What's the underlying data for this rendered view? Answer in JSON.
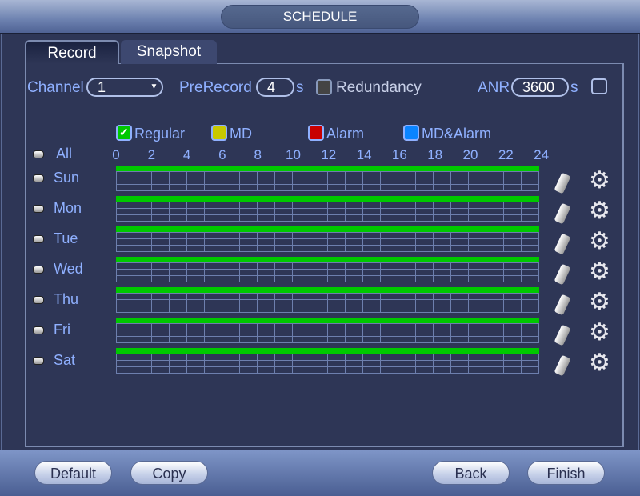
{
  "title": "SCHEDULE",
  "tabs": [
    {
      "label": "Record",
      "active": true
    },
    {
      "label": "Snapshot",
      "active": false
    }
  ],
  "settings": {
    "channel_label": "Channel",
    "channel_value": "1",
    "prerecord_label": "PreRecord",
    "prerecord_value": "4",
    "prerecord_unit": "s",
    "redundancy_label": "Redundancy",
    "redundancy_checked": false,
    "anr_label": "ANR",
    "anr_value": "3600",
    "anr_unit": "s",
    "anr_checked": false
  },
  "legend": [
    {
      "label": "Regular",
      "color": "#00c800",
      "checked": true
    },
    {
      "label": "MD",
      "color": "#c8c800",
      "checked": false
    },
    {
      "label": "Alarm",
      "color": "#c80000",
      "checked": false
    },
    {
      "label": "MD&Alarm",
      "color": "#0a84ff",
      "checked": false
    }
  ],
  "all_label": "All",
  "hours": [
    "0",
    "2",
    "4",
    "6",
    "8",
    "10",
    "12",
    "14",
    "16",
    "18",
    "20",
    "22",
    "24"
  ],
  "days": [
    "Sun",
    "Mon",
    "Tue",
    "Wed",
    "Thu",
    "Fri",
    "Sat"
  ],
  "schedule_fill": "Regular 00:00-24:00 all days",
  "buttons": {
    "default": "Default",
    "copy": "Copy",
    "back": "Back",
    "finish": "Finish"
  }
}
